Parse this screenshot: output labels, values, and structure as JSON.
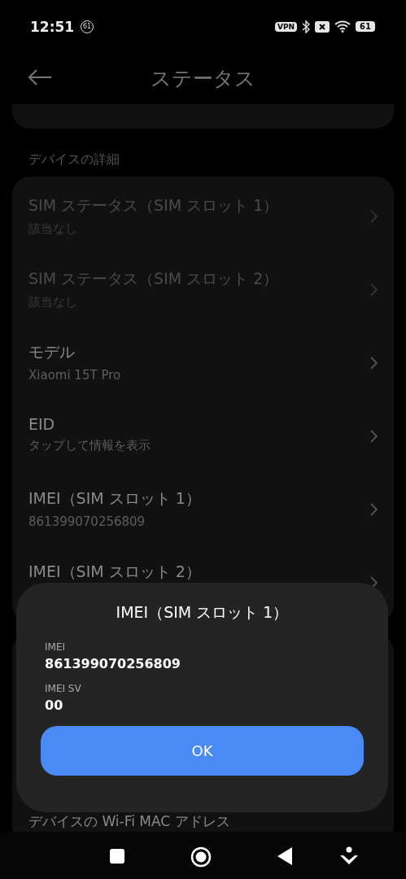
{
  "status_bar": {
    "time": "12:51",
    "notification_badge": "61",
    "vpn": "VPN",
    "battery": "61"
  },
  "header": {
    "title": "ステータス"
  },
  "section": {
    "title": "デバイスの詳細"
  },
  "rows": [
    {
      "title": "SIM ステータス（SIM スロット 1）",
      "subtitle": "該当なし",
      "disabled": true
    },
    {
      "title": "SIM ステータス（SIM スロット 2）",
      "subtitle": "該当なし",
      "disabled": true
    },
    {
      "title": "モデル",
      "subtitle": "Xiaomi 15T Pro",
      "disabled": false
    },
    {
      "title": "EID",
      "subtitle": "タップして情報を表示",
      "disabled": false
    },
    {
      "title": "IMEI（SIM スロット 1）",
      "subtitle": "861399070256809",
      "disabled": false
    },
    {
      "title": "IMEI（SIM スロット 2）",
      "disabled": false
    }
  ],
  "lower_row": {
    "title": "デバイスの Wi-Fi MAC アドレス"
  },
  "dialog": {
    "title": "IMEI（SIM スロット 1）",
    "fields": [
      {
        "label": "IMEI",
        "value": "861399070256809"
      },
      {
        "label": "IMEI SV",
        "value": "00"
      }
    ],
    "button": "OK"
  }
}
